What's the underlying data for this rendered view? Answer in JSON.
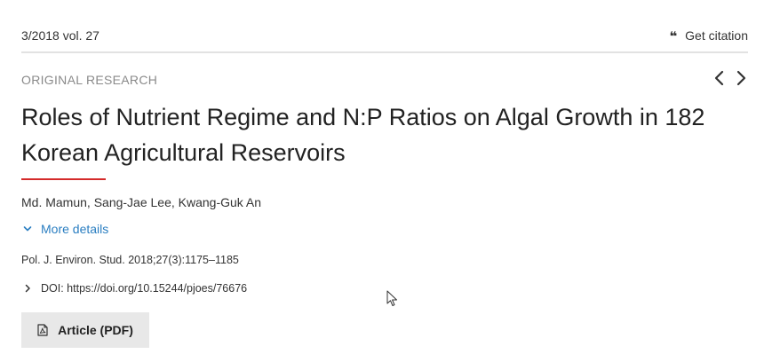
{
  "header": {
    "issue": "3/2018 vol. 27",
    "citation_label": "Get citation",
    "citation_icon": "quote-icon"
  },
  "article": {
    "category": "ORIGINAL RESEARCH",
    "title": "Roles of Nutrient Regime and N:P Ratios on Algal Growth in 182 Korean Agricultural Reservoirs",
    "authors": "Md. Mamun, Sang-Jae Lee, Kwang-Guk An",
    "more_details_label": "More details",
    "journal_citation": "Pol. J. Environ. Stud. 2018;27(3):1175–1185",
    "doi": "DOI: https://doi.org/10.15244/pjoes/76676",
    "pdf_label": "Article (PDF)"
  },
  "colors": {
    "accent_red": "#d42a2a",
    "link_blue": "#2a7ec1",
    "button_gray": "#e8e8e8"
  }
}
